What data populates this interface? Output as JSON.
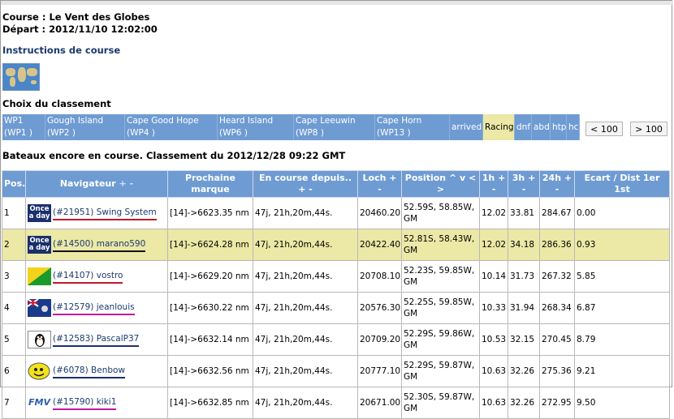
{
  "course_line": "Course : Le Vent des Globes",
  "depart_line": "Départ : 2012/11/10 12:02:00",
  "instructions_link": "Instructions de course",
  "choix_title": "Choix du classement",
  "marks": [
    {
      "label1": "WP1",
      "label2": "(WP1 )"
    },
    {
      "label1": "Gough Island",
      "label2": "(WP2 )"
    },
    {
      "label1": "Cape Good Hope",
      "label2": "(WP4 )"
    },
    {
      "label1": "Heard Island",
      "label2": "(WP6 )"
    },
    {
      "label1": "Cape Leeuwin",
      "label2": "(WP8 )"
    },
    {
      "label1": "Cape Horn",
      "label2": "(WP13 )"
    }
  ],
  "status_tabs": [
    "arrived",
    "Racing",
    "dnf",
    "abd",
    "htp",
    "hc"
  ],
  "selected_status": "Racing",
  "prev_button": "< 100",
  "next_button": "> 100",
  "subtitle": "Bateaux encore en course. Classement du 2012/12/28 09:22 GMT",
  "table": {
    "headers": {
      "pos": "Pos.",
      "navigateur": "Navigateur",
      "nav_sort": "+ -",
      "prochaine": "Prochaine marque",
      "encourse": "En course depuis..",
      "encourse_sort": "+ -",
      "loch": "Loch",
      "loch_sort": "+",
      "position": "Position",
      "position_sort": "^ v <",
      "position_sort2": ">",
      "h1": "1h",
      "h1_sort": "+",
      "h3": "3h",
      "h3_sort": "+",
      "h24": "24h",
      "h24_sort": "+",
      "sort_minus": "-",
      "ecart": "Ecart / Dist 1er 1st"
    },
    "rows": [
      {
        "pos": "1",
        "flag": "oad",
        "flag_text": "Once a day",
        "nav": "(#21951) Swing System",
        "underline": "#c0182a",
        "prochaine": "[14]->6623.35 nm",
        "encourse": "47j, 21h,20m,44s.",
        "loch": "20460.20",
        "position": "52.59S, 58.85W, GM",
        "h1": "12.02",
        "h3": "33.81",
        "h24": "284.67",
        "ecart": "0.00",
        "highlight": false
      },
      {
        "pos": "2",
        "flag": "oad",
        "flag_text": "Once a day",
        "nav": "(#14500) marano590",
        "underline": "#111111",
        "prochaine": "[14]->6624.28 nm",
        "encourse": "47j, 21h,20m,44s.",
        "loch": "20422.40",
        "position": "52.81S, 58.43W, GM",
        "h1": "12.02",
        "h3": "34.18",
        "h24": "286.36",
        "ecart": "0.93",
        "highlight": true
      },
      {
        "pos": "3",
        "flag": "green",
        "flag_text": "",
        "nav": "(#14107) vostro",
        "underline": "#c0182a",
        "prochaine": "[14]->6629.20 nm",
        "encourse": "47j, 21h,20m,44s.",
        "loch": "20708.10",
        "position": "52.23S, 59.85W, GM",
        "h1": "10.14",
        "h3": "31.73",
        "h24": "267.32",
        "ecart": "5.85",
        "highlight": false
      },
      {
        "pos": "4",
        "flag": "uk",
        "flag_text": "",
        "nav": "(#12579) jeanlouis",
        "underline": "#c0189a",
        "prochaine": "[14]->6630.22 nm",
        "encourse": "47j, 21h,20m,44s.",
        "loch": "20576.30",
        "position": "52.25S, 59.85W, GM",
        "h1": "10.33",
        "h3": "31.94",
        "h24": "268.34",
        "ecart": "6.87",
        "highlight": false
      },
      {
        "pos": "5",
        "flag": "tux",
        "flag_text": "",
        "nav": "(#12583) PascalP37",
        "underline": "#1a2f6b",
        "prochaine": "[14]->6632.14 nm",
        "encourse": "47j, 21h,20m,44s.",
        "loch": "20709.20",
        "position": "52.29S, 59.86W, GM",
        "h1": "10.53",
        "h3": "32.15",
        "h24": "270.45",
        "ecart": "8.79",
        "highlight": false
      },
      {
        "pos": "6",
        "flag": "smile",
        "flag_text": "",
        "nav": "(#6078) Benbow",
        "underline": "#1a2f6b",
        "prochaine": "[14]->6632.56 nm",
        "encourse": "47j, 21h,20m,44s.",
        "loch": "20777.10",
        "position": "52.29S, 59.87W, GM",
        "h1": "10.63",
        "h3": "32.26",
        "h24": "275.36",
        "ecart": "9.21",
        "highlight": false
      },
      {
        "pos": "7",
        "flag": "fmv",
        "flag_text": "FMV",
        "nav": "(#15790) kiki1",
        "underline": "#c0189a",
        "prochaine": "[14]->6632.85 nm",
        "encourse": "47j, 21h,20m,44s.",
        "loch": "20671.00",
        "position": "52.30S, 59.87W, GM",
        "h1": "10.63",
        "h3": "32.26",
        "h24": "272.95",
        "ecart": "9.50",
        "highlight": false
      }
    ]
  }
}
